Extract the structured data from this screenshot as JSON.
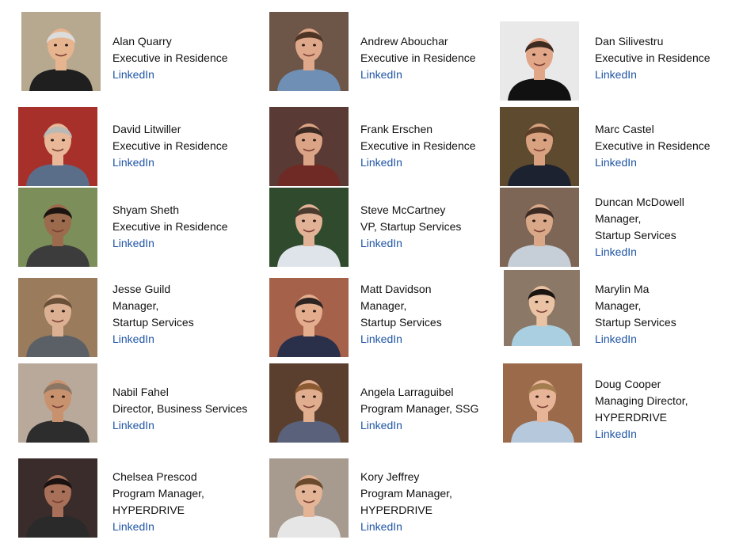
{
  "colors": {
    "text": "#111111",
    "link": "#1f55a5",
    "background": "#ffffff"
  },
  "people": [
    {
      "name": "Alan Quarry",
      "title_lines": [
        "Executive in Residence"
      ],
      "link_label": "LinkedIn",
      "icon": "person-photo",
      "photo": {
        "bg": "#b7a98f",
        "skin": "#e6b48f",
        "hair": "#dcdcdc",
        "shirt": "#1f1f1f"
      }
    },
    {
      "name": "Andrew Abouchar",
      "title_lines": [
        "Executive in Residence"
      ],
      "link_label": "LinkedIn",
      "icon": "person-photo",
      "photo": {
        "bg": "#6d5548",
        "skin": "#e0a88a",
        "hair": "#4d3425",
        "shirt": "#6f8fb4"
      }
    },
    {
      "name": "Dan Silivestru",
      "title_lines": [
        "Executive in Residence"
      ],
      "link_label": "LinkedIn",
      "icon": "person-photo",
      "photo": {
        "bg": "#e9e9e9",
        "skin": "#e1a587",
        "hair": "#3d2b22",
        "shirt": "#111111"
      }
    },
    {
      "name": "David Litwiller",
      "title_lines": [
        "Executive in Residence"
      ],
      "link_label": "LinkedIn",
      "icon": "person-photo",
      "photo": {
        "bg": "#a8302a",
        "skin": "#e8b898",
        "hair": "#b9b9b6",
        "shirt": "#5a6e8a"
      }
    },
    {
      "name": "Frank Erschen",
      "title_lines": [
        "Executive in Residence"
      ],
      "link_label": "LinkedIn",
      "icon": "person-photo",
      "photo": {
        "bg": "#5a3a34",
        "skin": "#dba486",
        "hair": "#3b2a24",
        "shirt": "#6f2a25"
      }
    },
    {
      "name": "Marc Castel",
      "title_lines": [
        "Executive in Residence"
      ],
      "link_label": "LinkedIn",
      "icon": "person-photo",
      "photo": {
        "bg": "#5d4a2f",
        "skin": "#d8a17f",
        "hair": "#5b3d27",
        "shirt": "#1d2230"
      }
    },
    {
      "name": "Shyam Sheth",
      "title_lines": [
        "Executive in Residence"
      ],
      "link_label": "LinkedIn",
      "icon": "person-photo",
      "photo": {
        "bg": "#7c8f5a",
        "skin": "#9c6a4c",
        "hair": "#1b1410",
        "shirt": "#3c3c3c"
      }
    },
    {
      "name": "Steve McCartney",
      "title_lines": [
        "VP, Startup Services"
      ],
      "link_label": "LinkedIn",
      "icon": "person-photo",
      "photo": {
        "bg": "#2f4a2c",
        "skin": "#e2b296",
        "hair": "#4b3b2f",
        "shirt": "#dfe4ea"
      }
    },
    {
      "name": "Duncan McDowell",
      "title_lines": [
        "Manager,",
        "Startup Services"
      ],
      "link_label": "LinkedIn",
      "icon": "person-photo",
      "photo": {
        "bg": "#7e6656",
        "skin": "#d8a889",
        "hair": "#3a2a22",
        "shirt": "#c6cfd7"
      }
    },
    {
      "name": "Jesse Guild",
      "title_lines": [
        "Manager,",
        "Startup Services"
      ],
      "link_label": "LinkedIn",
      "icon": "person-photo",
      "photo": {
        "bg": "#9a7c5d",
        "skin": "#dcb193",
        "hair": "#6a5038",
        "shirt": "#5b6066"
      }
    },
    {
      "name": "Matt Davidson",
      "title_lines": [
        "Manager,",
        "Startup Services"
      ],
      "link_label": "LinkedIn",
      "icon": "person-photo",
      "photo": {
        "bg": "#a5614a",
        "skin": "#e3ad8e",
        "hair": "#2d2320",
        "shirt": "#2a2f4a"
      }
    },
    {
      "name": "Marylin Ma",
      "title_lines": [
        "Manager,",
        "Startup Services"
      ],
      "link_label": "LinkedIn",
      "icon": "person-photo",
      "photo": {
        "bg": "#8b7866",
        "skin": "#eac3a5",
        "hair": "#1b1512",
        "shirt": "#a9cfe0"
      }
    },
    {
      "name": "Nabil Fahel",
      "title_lines": [
        "Director, Business Services"
      ],
      "link_label": "LinkedIn",
      "icon": "person-photo",
      "photo": {
        "bg": "#b9a99b",
        "skin": "#c9926f",
        "hair": "#8a7663",
        "shirt": "#2d2d2d"
      }
    },
    {
      "name": "Angela Larraguibel",
      "title_lines": [
        "Program Manager, SSG"
      ],
      "link_label": "LinkedIn",
      "icon": "person-photo",
      "photo": {
        "bg": "#5b3f2e",
        "skin": "#e0ae8f",
        "hair": "#8b5a33",
        "shirt": "#59627a"
      }
    },
    {
      "name": "Doug Cooper",
      "title_lines": [
        "Managing Director,",
        "HYPERDRIVE"
      ],
      "link_label": "LinkedIn",
      "icon": "person-photo",
      "photo": {
        "bg": "#9b6a4a",
        "skin": "#e8b497",
        "hair": "#a37d4e",
        "shirt": "#b6c8dc"
      }
    },
    {
      "name": "Chelsea Prescod",
      "title_lines": [
        "Program Manager,",
        "HYPERDRIVE"
      ],
      "link_label": "LinkedIn",
      "icon": "person-photo",
      "photo": {
        "bg": "#3a2c2a",
        "skin": "#a87059",
        "hair": "#1a1210",
        "shirt": "#2a2a2a"
      }
    },
    {
      "name": "Kory Jeffrey",
      "title_lines": [
        "Program Manager,",
        "HYPERDRIVE"
      ],
      "link_label": "LinkedIn",
      "icon": "person-photo",
      "photo": {
        "bg": "#a79a8f",
        "skin": "#e3b496",
        "hair": "#6a4a2c",
        "shirt": "#e6e6e6"
      }
    }
  ]
}
